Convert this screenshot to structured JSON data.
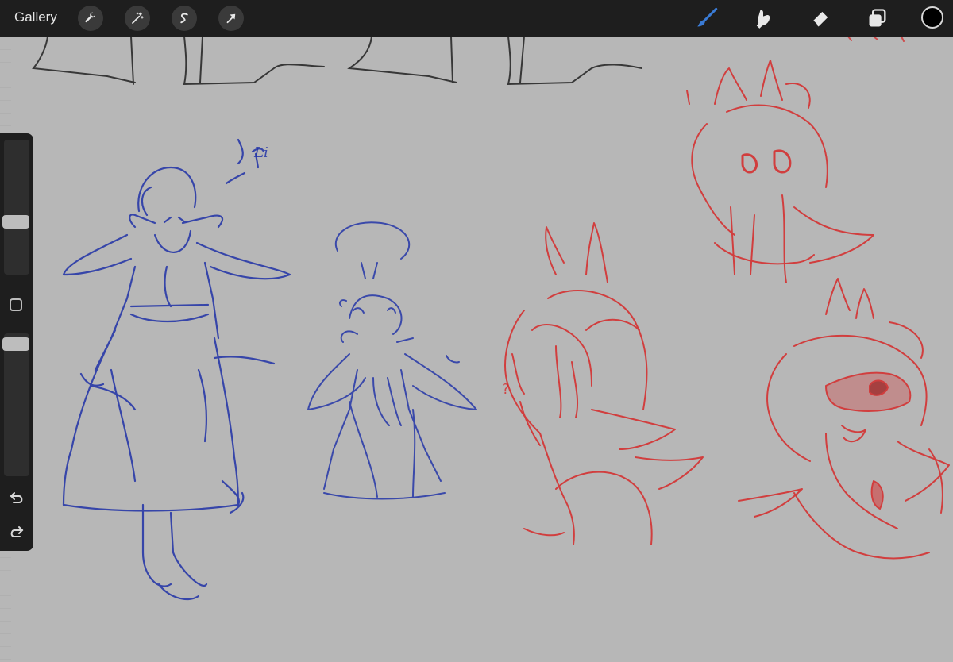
{
  "topbar": {
    "gallery_label": "Gallery",
    "left_tools": [
      {
        "name": "actions",
        "icon": "wrench-icon"
      },
      {
        "name": "adjustments",
        "icon": "magic-wand-icon"
      },
      {
        "name": "selection",
        "icon": "selection-s-icon"
      },
      {
        "name": "transform",
        "icon": "arrow-cursor-icon"
      }
    ],
    "right_tools": [
      {
        "name": "brush",
        "icon": "brush-icon",
        "active": true
      },
      {
        "name": "smudge",
        "icon": "smudge-finger-icon"
      },
      {
        "name": "eraser",
        "icon": "eraser-icon"
      },
      {
        "name": "layers",
        "icon": "layers-icon"
      }
    ],
    "current_color": "#000000",
    "active_color": "#3a7bd5"
  },
  "sidebar": {
    "brush_size_level": 0.38,
    "brush_opacity_level": 0.97,
    "icons": [
      "modify-square-icon",
      "undo-icon",
      "redo-icon"
    ]
  },
  "canvas": {
    "background": "#b7b7b7",
    "annotations": {
      "blue_text": "Li",
      "red_question": "?"
    },
    "sketch_colors": {
      "pencil": "#2a2a2a",
      "blue": "#2536a8",
      "red": "#d62a2a"
    }
  }
}
